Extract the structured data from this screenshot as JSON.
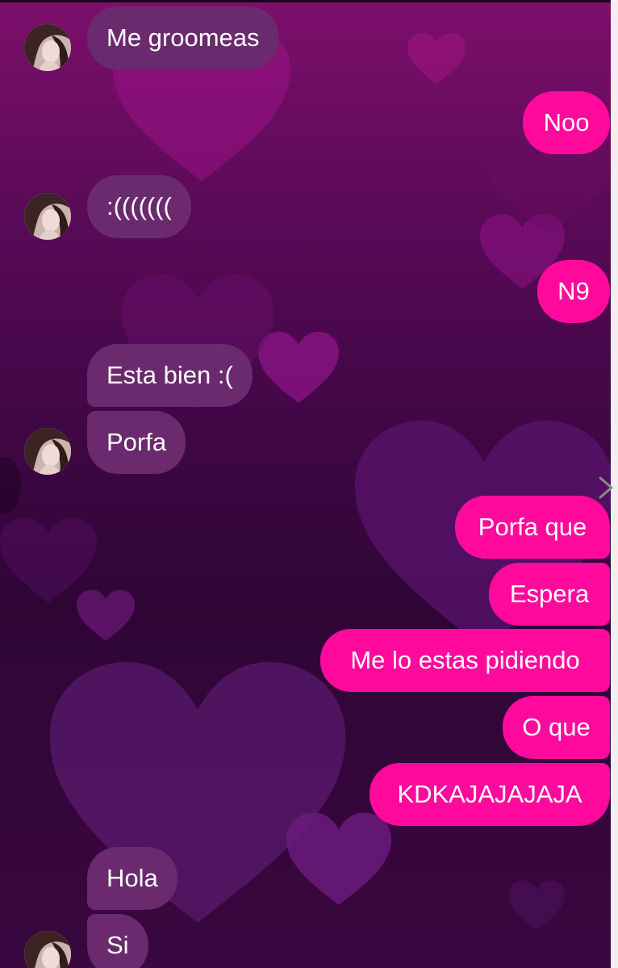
{
  "chat": {
    "theme": {
      "incoming_color": "#6b2a6e",
      "outgoing_color": "#ff0a9c",
      "text_color": "#ffffff"
    },
    "messages": [
      {
        "sender": "them",
        "text": "Me groomeas"
      },
      {
        "sender": "me",
        "text": "Noo"
      },
      {
        "sender": "them",
        "text": ":((((((("
      },
      {
        "sender": "me",
        "text": "N9"
      },
      {
        "sender": "them",
        "text": "Esta bien :("
      },
      {
        "sender": "them",
        "text": "Porfa"
      },
      {
        "sender": "me",
        "text": "Porfa que"
      },
      {
        "sender": "me",
        "text": "Espera"
      },
      {
        "sender": "me",
        "text": "Me lo estas pidiendo"
      },
      {
        "sender": "me",
        "text": "O que"
      },
      {
        "sender": "me",
        "text": "KDKAJAJAJAJA"
      },
      {
        "sender": "them",
        "text": "Hola"
      },
      {
        "sender": "them",
        "text": "Si"
      }
    ],
    "icons": {
      "avatar": "contact-avatar-icon",
      "next": "chevron-right-icon"
    }
  }
}
